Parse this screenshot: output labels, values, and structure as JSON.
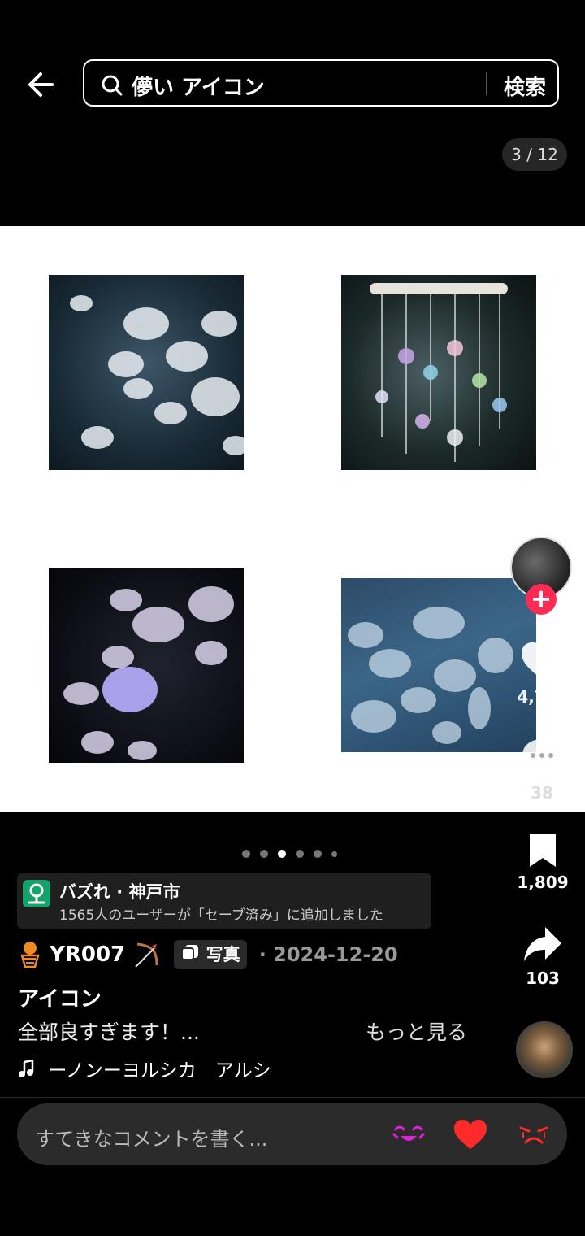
{
  "search": {
    "query": "儚い アイコン",
    "submit_label": "検索"
  },
  "gallery": {
    "counter": "3 / 12"
  },
  "actions": {
    "likes": "4,746",
    "comments": "38",
    "saves": "1,809",
    "shares": "103"
  },
  "location": {
    "title": "バズれ · 神戸市",
    "subtitle": "1565人のユーザーが「セーブ済み」に追加しました"
  },
  "post": {
    "author": "YR007",
    "badge": "写真",
    "date": "· 2024-12-20",
    "title": "アイコン",
    "description": "全部良すぎます！...",
    "more_label": "もっと見る",
    "music": "ーノンーヨルシカ　アルシ"
  },
  "comment": {
    "placeholder": "すてきなコメントを書く..."
  },
  "colors": {
    "accent": "#fe2c55",
    "like_red": "#ff2b2b",
    "emoji_magenta": "#e020e0"
  }
}
